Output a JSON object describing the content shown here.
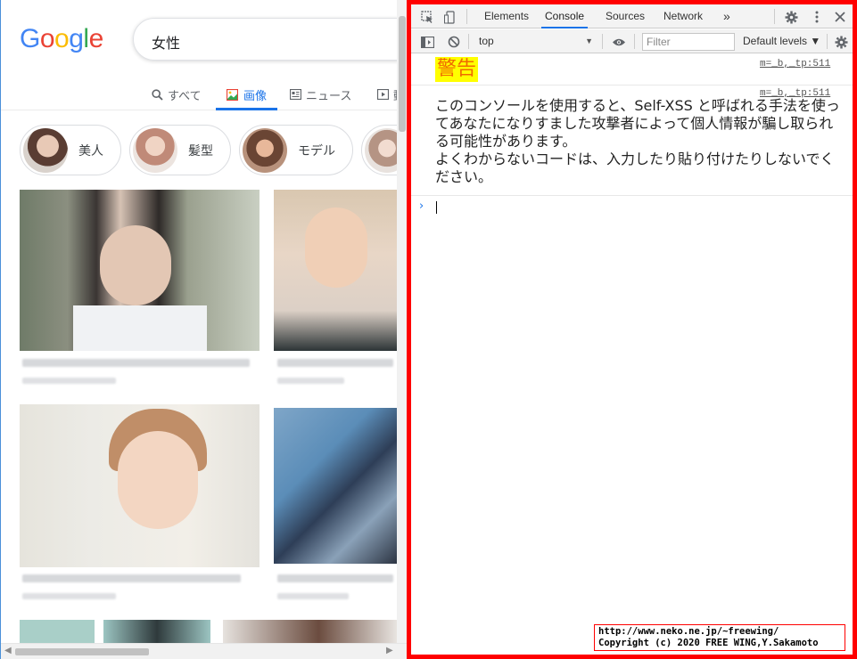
{
  "google": {
    "logo_letters": [
      {
        "ch": "G",
        "color": "#4285F4"
      },
      {
        "ch": "o",
        "color": "#EA4335"
      },
      {
        "ch": "o",
        "color": "#FBBC05"
      },
      {
        "ch": "g",
        "color": "#4285F4"
      },
      {
        "ch": "l",
        "color": "#34A853"
      },
      {
        "ch": "e",
        "color": "#EA4335"
      }
    ],
    "query": "女性",
    "tabs": [
      {
        "label": "すべて",
        "icon": "search-icon"
      },
      {
        "label": "画像",
        "icon": "image-icon",
        "active": true
      },
      {
        "label": "ニュース",
        "icon": "news-icon"
      },
      {
        "label": "動",
        "icon": "video-icon"
      }
    ],
    "chips": [
      {
        "label": "美人",
        "color": "#b9978a"
      },
      {
        "label": "髪型",
        "color": "#cfa49a"
      },
      {
        "label": "モデル",
        "color": "#8a6a58"
      },
      {
        "label": "",
        "color": "#d8c8c0"
      }
    ],
    "accent": "#1a73e8"
  },
  "devtools": {
    "tabs": [
      "Elements",
      "Console",
      "Sources",
      "Network"
    ],
    "active_tab": "Console",
    "more": "»",
    "context": "top",
    "filter_placeholder": "Filter",
    "levels": "Default levels ▼",
    "messages": {
      "warning_title": "警告",
      "source_1": "m=_b,_tp:511",
      "source_2": "m=_b,_tp:511",
      "body": "このコンソールを使用すると、Self-XSS と呼ばれる手法を使ってあなたになりすました攻撃者によって個人情報が騙し取られる可能性があります。\nよくわからないコードは、入力したり貼り付けたりしないでください。"
    },
    "prompt_symbol": "›",
    "highlight_color": "#ff0000"
  },
  "credit": {
    "line1": "http://www.neko.ne.jp/~freewing/",
    "line2": "Copyright (c) 2020 FREE WING,Y.Sakamoto"
  }
}
